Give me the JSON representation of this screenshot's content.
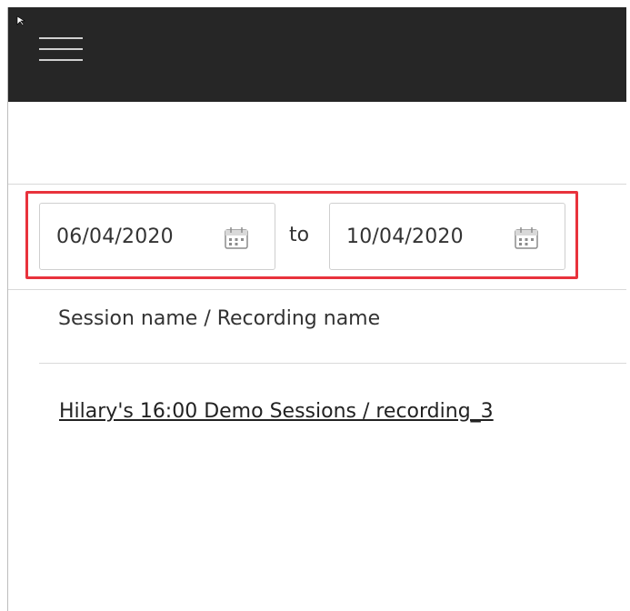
{
  "header": {
    "menu_icon": "hamburger-menu-icon",
    "background_color": "#262626"
  },
  "date_range": {
    "start_date": "06/04/2020",
    "separator_label": "to",
    "end_date": "10/04/2020",
    "calendar_icon": "calendar-icon",
    "highlight_color": "#e8323c"
  },
  "table": {
    "column_header": "Session name / Recording name",
    "rows": [
      {
        "link_text": "Hilary's 16:00 Demo Sessions / recording_3"
      }
    ]
  }
}
